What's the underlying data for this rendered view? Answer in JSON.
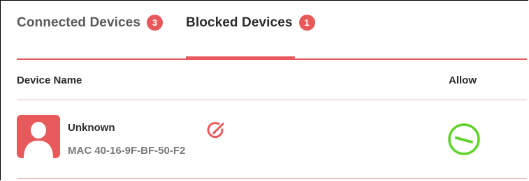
{
  "colors": {
    "accent": "#e8595b",
    "allow_green": "#5fd32a",
    "divider": "#f0b8b8"
  },
  "tabs": [
    {
      "label": "Connected Devices",
      "badge": "3",
      "active": false
    },
    {
      "label": "Blocked Devices",
      "badge": "1",
      "active": true
    }
  ],
  "table": {
    "headers": {
      "device_name": "Device Name",
      "allow": "Allow"
    },
    "rows": [
      {
        "name": "Unknown",
        "mac": "MAC 40-16-9F-BF-50-F2",
        "avatar_icon": "user-icon",
        "edit_icon": "pencil-icon",
        "allow_icon": "remove-circle-icon"
      }
    ]
  }
}
